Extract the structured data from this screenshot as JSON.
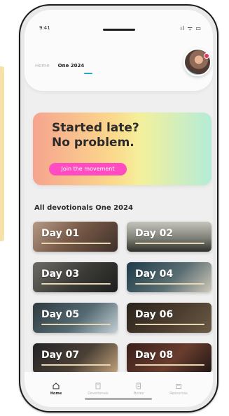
{
  "status": {
    "time": "9:41",
    "icons": "ıl ᯤ ▭"
  },
  "tabs": [
    {
      "label": "Home"
    },
    {
      "label": "One 2024"
    }
  ],
  "promo": {
    "title": "Started late?\nNo problem.",
    "button": "Join the movement"
  },
  "section": {
    "title": "All devotionals One 2024"
  },
  "devotionals": [
    {
      "label": "Day 01"
    },
    {
      "label": "Day 02"
    },
    {
      "label": "Day 03"
    },
    {
      "label": "Day 04"
    },
    {
      "label": "Day 05"
    },
    {
      "label": "Day 06"
    },
    {
      "label": "Day 07"
    },
    {
      "label": "Day 08"
    }
  ],
  "bottom_nav": [
    {
      "label": "Home",
      "icon": "home-icon"
    },
    {
      "label": "Devotionals",
      "icon": "book-icon"
    },
    {
      "label": "Notes",
      "icon": "notes-icon"
    },
    {
      "label": "Resources",
      "icon": "resources-icon"
    }
  ]
}
